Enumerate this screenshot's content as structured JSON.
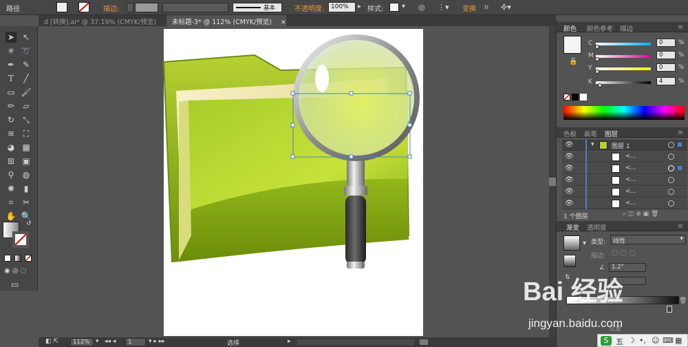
{
  "control_bar": {
    "path_label": "路径",
    "stroke_label": "描边:",
    "stroke_style": "基本",
    "opacity_label": "不透明度:",
    "opacity_value": "100%",
    "style_label": "样式:",
    "transform_label": "变换"
  },
  "tabs": [
    {
      "label": "d [转换].ai* @ 37.19% (CMYK/预览)",
      "active": false
    },
    {
      "label": "未标题-3* @ 112% (CMYK/预览)",
      "active": true,
      "close": "×"
    }
  ],
  "status_bar": {
    "zoom": "112%",
    "page": "1",
    "tool_name": "选择"
  },
  "color_panel": {
    "tabs": [
      "颜色",
      "颜色参考",
      "描边"
    ],
    "channels": [
      {
        "label": "C",
        "value": "0",
        "unit": "%"
      },
      {
        "label": "M",
        "value": "0",
        "unit": "%"
      },
      {
        "label": "Y",
        "value": "0",
        "unit": "%"
      },
      {
        "label": "K",
        "value": "4",
        "unit": "%"
      }
    ]
  },
  "layers_panel": {
    "tabs": [
      "色板",
      "画笔",
      "图层"
    ],
    "layer_name": "图层 1",
    "sublayers": [
      "<...",
      "<...",
      "<...",
      "<...",
      "<..."
    ],
    "footer": "1 个图层"
  },
  "gradient_panel": {
    "tabs": [
      "渐变",
      "透明度"
    ],
    "type_label": "类型:",
    "type_value": "线性",
    "stroke_label": "描边:",
    "angle_value": "1.2°",
    "position_label": "位置"
  },
  "watermark": {
    "brand": "Bai 经验",
    "url": "jingyan.baidu.com"
  },
  "ime_bar": {
    "mode": "五"
  },
  "colors": {
    "folder_green": "#9cbf1a",
    "folder_light": "#d9ef4a",
    "selection_blue": "#4e7ed1",
    "accent_orange": "#e89a3c"
  }
}
